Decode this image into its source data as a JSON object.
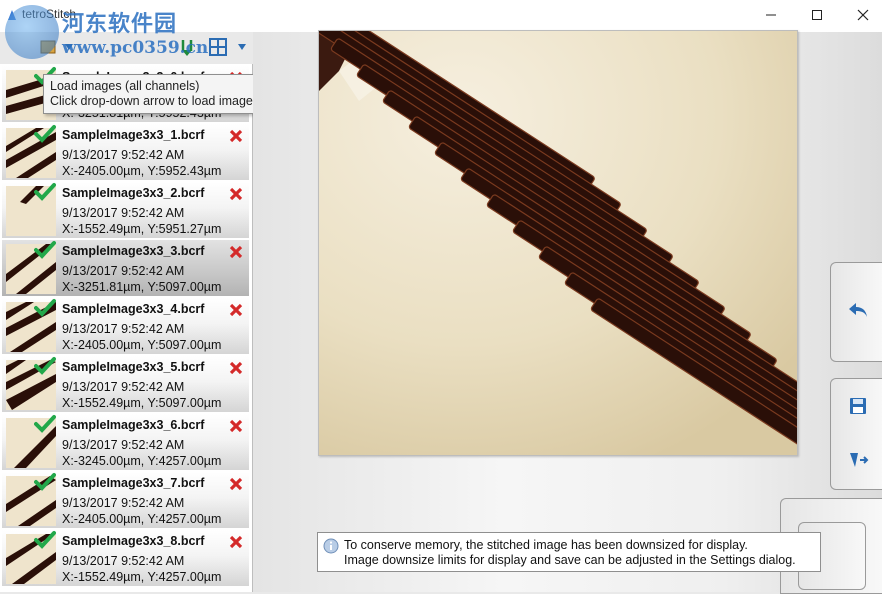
{
  "window": {
    "title": "tetroStitch",
    "controls": {
      "minimize": "minimize-icon",
      "maximize": "maximize-icon",
      "close": "close-icon"
    }
  },
  "watermark": {
    "text": "河东软件园",
    "url": "www.pc0359.cn"
  },
  "toolbar": {
    "icons": [
      "load-images-icon",
      "dropdown-arrow-icon",
      "sort-icon",
      "grid-layout-icon",
      "dropdown-arrow-icon"
    ]
  },
  "tooltip": {
    "line1": "Load images (all channels)",
    "line2": "Click drop-down arrow to load images using advanced options"
  },
  "image_list": {
    "items": [
      {
        "name": "SampleImage3x3_0.bcrf",
        "date": "",
        "coords": "X:-3251.81µm, Y:5952.43µm",
        "status": "loaded",
        "selected": false
      },
      {
        "name": "SampleImage3x3_1.bcrf",
        "date": "9/13/2017 9:52:42 AM",
        "coords": "X:-2405.00µm, Y:5952.43µm",
        "status": "loaded",
        "selected": false
      },
      {
        "name": "SampleImage3x3_2.bcrf",
        "date": "9/13/2017 9:52:42 AM",
        "coords": "X:-1552.49µm, Y:5951.27µm",
        "status": "loaded",
        "selected": false
      },
      {
        "name": "SampleImage3x3_3.bcrf",
        "date": "9/13/2017 9:52:42 AM",
        "coords": "X:-3251.81µm, Y:5097.00µm",
        "status": "loaded",
        "selected": true
      },
      {
        "name": "SampleImage3x3_4.bcrf",
        "date": "9/13/2017 9:52:42 AM",
        "coords": "X:-2405.00µm, Y:5097.00µm",
        "status": "loaded",
        "selected": false
      },
      {
        "name": "SampleImage3x3_5.bcrf",
        "date": "9/13/2017 9:52:42 AM",
        "coords": "X:-1552.49µm, Y:5097.00µm",
        "status": "loaded",
        "selected": false
      },
      {
        "name": "SampleImage3x3_6.bcrf",
        "date": "9/13/2017 9:52:42 AM",
        "coords": "X:-3245.00µm, Y:4257.00µm",
        "status": "loaded",
        "selected": false
      },
      {
        "name": "SampleImage3x3_7.bcrf",
        "date": "9/13/2017 9:52:42 AM",
        "coords": "X:-2405.00µm, Y:4257.00µm",
        "status": "loaded",
        "selected": false
      },
      {
        "name": "SampleImage3x3_8.bcrf",
        "date": "9/13/2017 9:52:42 AM",
        "coords": "X:-1552.49µm, Y:4257.00µm",
        "status": "loaded",
        "selected": false
      }
    ]
  },
  "side_buttons": [
    "undo-icon",
    "save-icon",
    "export-icon"
  ],
  "notice": {
    "icon": "info-icon",
    "line1": "To conserve memory, the stitched image has been downsized for display.",
    "line2": "Image downsize limits for display and save can be adjusted in the Settings dialog."
  },
  "colors": {
    "check": "#22a84a",
    "remove": "#d42a2a",
    "accent": "#2b6cb3",
    "stripe": "#2a0f08",
    "background": "#e8dec4"
  }
}
